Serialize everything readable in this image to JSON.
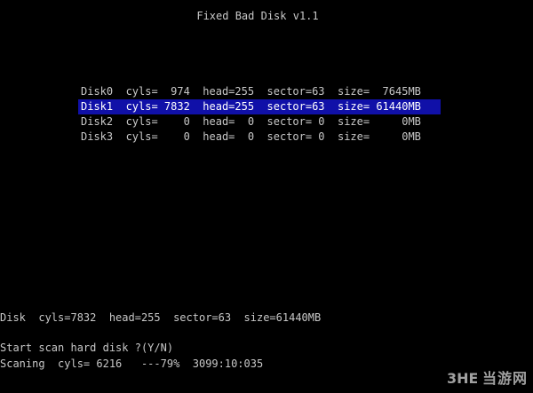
{
  "app": {
    "title": "Fixed Bad Disk v1.1"
  },
  "disks": [
    {
      "text": "Disk0  cyls=  974  head=255  sector=63  size=  7645MB",
      "selected": false
    },
    {
      "text": "Disk1  cyls= 7832  head=255  sector=63  size= 61440MB",
      "selected": true
    },
    {
      "text": "Disk2  cyls=    0  head=  0  sector= 0  size=     0MB",
      "selected": false
    },
    {
      "text": "Disk3  cyls=    0  head=  0  sector= 0  size=     0MB",
      "selected": false
    }
  ],
  "summary": {
    "text": "Disk  cyls=7832  head=255  sector=63  size=61440MB"
  },
  "prompt": {
    "text": "Start scan hard disk ?(Y/N)"
  },
  "status": {
    "text": "Scaning  cyls= 6216   ---79%  3099:10:035"
  },
  "colors": {
    "background": "#000000",
    "text": "#c8c8c8",
    "selection": "#1010a8",
    "selection_text": "#ffffff"
  },
  "watermark": {
    "logo_text": "3HE",
    "site_text": "当游网"
  }
}
